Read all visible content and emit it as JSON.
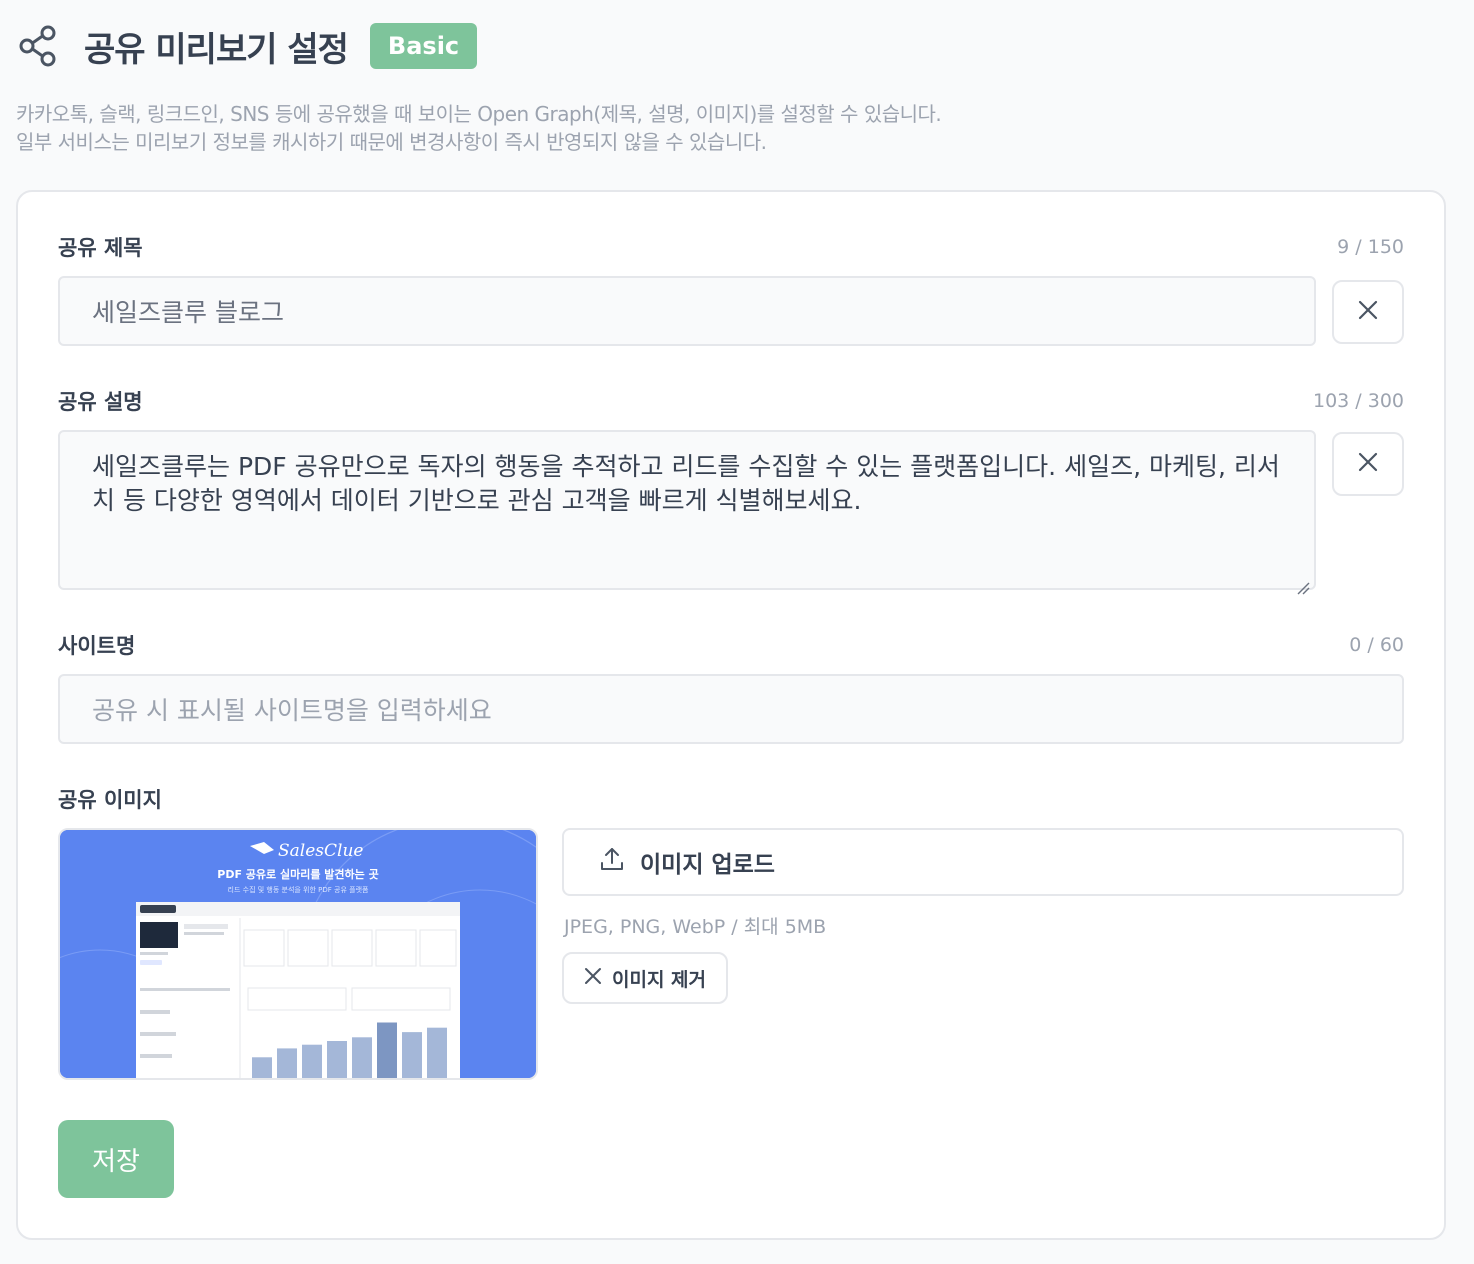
{
  "header": {
    "title": "공유 미리보기 설정",
    "badge": "Basic",
    "icon": "share-icon"
  },
  "description": {
    "line1": "카카오톡, 슬랙, 링크드인, SNS 등에 공유했을 때 보이는 Open Graph(제목, 설명, 이미지)를 설정할 수 있습니다.",
    "line2": "일부 서비스는 미리보기 정보를 캐시하기 때문에 변경사항이 즉시 반영되지 않을 수 있습니다."
  },
  "form": {
    "share_title": {
      "label": "공유 제목",
      "count": "9 / 150",
      "value": "세일즈클루 블로그"
    },
    "share_description": {
      "label": "공유 설명",
      "count": "103 / 300",
      "value": "세일즈클루는 PDF 공유만으로 독자의 행동을 추적하고 리드를 수집할 수 있는 플랫폼입니다. 세일즈, 마케팅, 리서치 등 다양한 영역에서 데이터 기반으로 관심 고객을 빠르게 식별해보세요."
    },
    "site_name": {
      "label": "사이트명",
      "count": "0 / 60",
      "value": "",
      "placeholder": "공유 시 표시될 사이트명을 입력하세요"
    },
    "share_image": {
      "label": "공유 이미지",
      "upload_label": "이미지 업로드",
      "hint": "JPEG, PNG, WebP / 최대 5MB",
      "remove_label": "이미지 제거",
      "preview": {
        "logo_text": "SalesClue",
        "headline": "PDF 공유로 실마리를 발견하는 곳",
        "subline": "리드 수집 및 행동 분석을 위한 PDF 공유 플랫폼",
        "bar_values": [
          0.28,
          0.4,
          0.45,
          0.5,
          0.55,
          0.75,
          0.62,
          0.68
        ]
      }
    },
    "save_label": "저장"
  },
  "colors": {
    "accent": "#7ec49b",
    "preview_bg": "#5b84f0"
  }
}
